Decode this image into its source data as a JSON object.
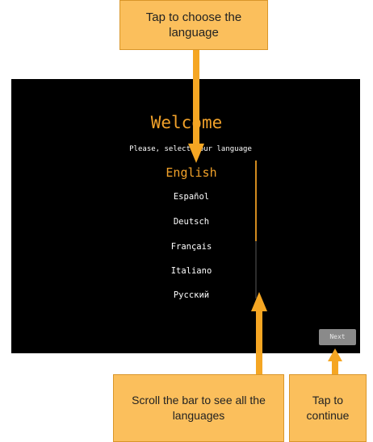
{
  "screen": {
    "title": "Welcome",
    "subtitle": "Please, select your language",
    "languages": [
      "English",
      "Español",
      "Deutsch",
      "Français",
      "Italiano",
      "Русский"
    ],
    "selected_language": "English",
    "next_label": "Next",
    "accent_color": "#f2a22a",
    "background_color": "#000000"
  },
  "callouts": {
    "choose_language": "Tap to choose the language",
    "scroll_bar": "Scroll the bar to see all the languages",
    "tap_continue": "Tap to continue",
    "callout_color": "#fbbf5c",
    "arrow_color": "#f5a623"
  }
}
